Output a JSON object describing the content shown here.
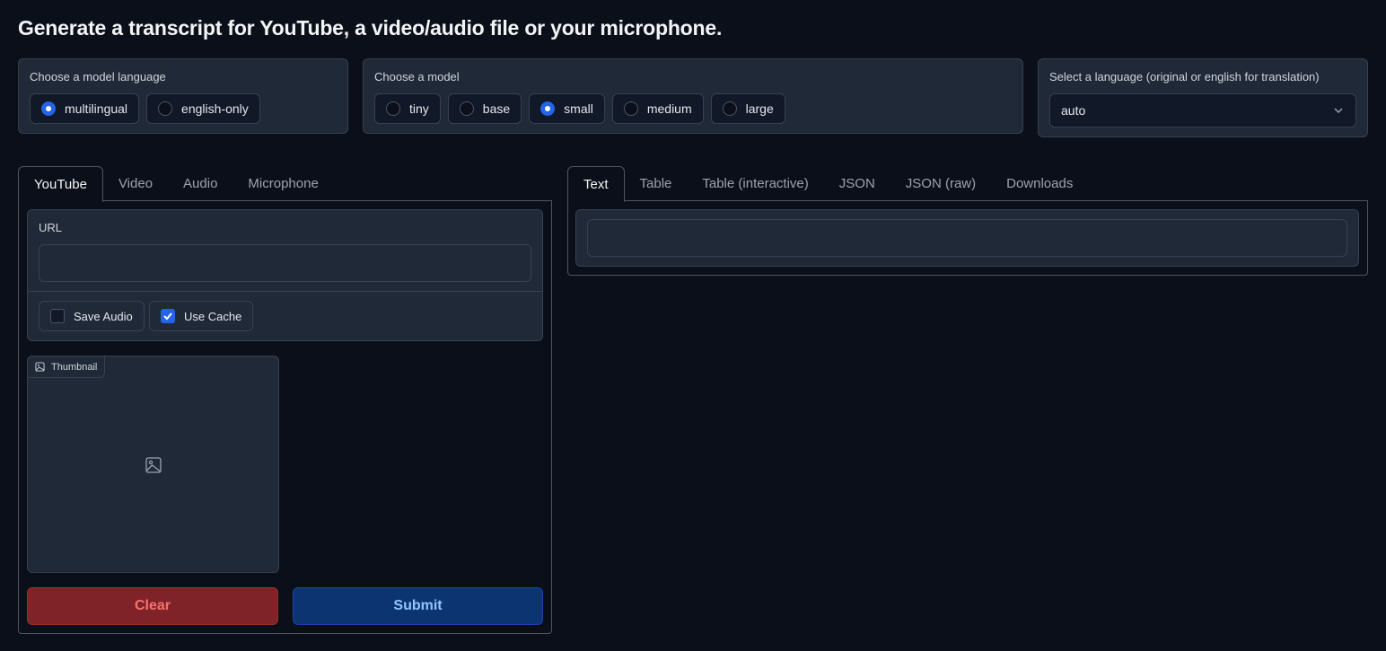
{
  "title": "Generate a transcript for YouTube, a video/audio file or your microphone.",
  "model_language": {
    "label": "Choose a model language",
    "options": [
      "multilingual",
      "english-only"
    ],
    "selected": "multilingual"
  },
  "model": {
    "label": "Choose a model",
    "options": [
      "tiny",
      "base",
      "small",
      "medium",
      "large"
    ],
    "selected": "small"
  },
  "language": {
    "label": "Select a language (original or english for translation)",
    "value": "auto"
  },
  "input_tabs": [
    "YouTube",
    "Video",
    "Audio",
    "Microphone"
  ],
  "input_active_tab": "YouTube",
  "youtube": {
    "url_label": "URL",
    "url_value": "",
    "save_audio_label": "Save Audio",
    "save_audio_checked": false,
    "use_cache_label": "Use Cache",
    "use_cache_checked": true,
    "thumbnail_label": "Thumbnail"
  },
  "buttons": {
    "clear": "Clear",
    "submit": "Submit"
  },
  "output_tabs": [
    "Text",
    "Table",
    "Table (interactive)",
    "JSON",
    "JSON (raw)",
    "Downloads"
  ],
  "output_active_tab": "Text",
  "output_text": "",
  "colors": {
    "background": "#0b0f19",
    "panel": "#1f2937",
    "accent": "#2563eb",
    "clear_bg": "#7f2328",
    "clear_text": "#f87171",
    "submit_bg": "#0b3470",
    "submit_text": "#93c5fd"
  }
}
